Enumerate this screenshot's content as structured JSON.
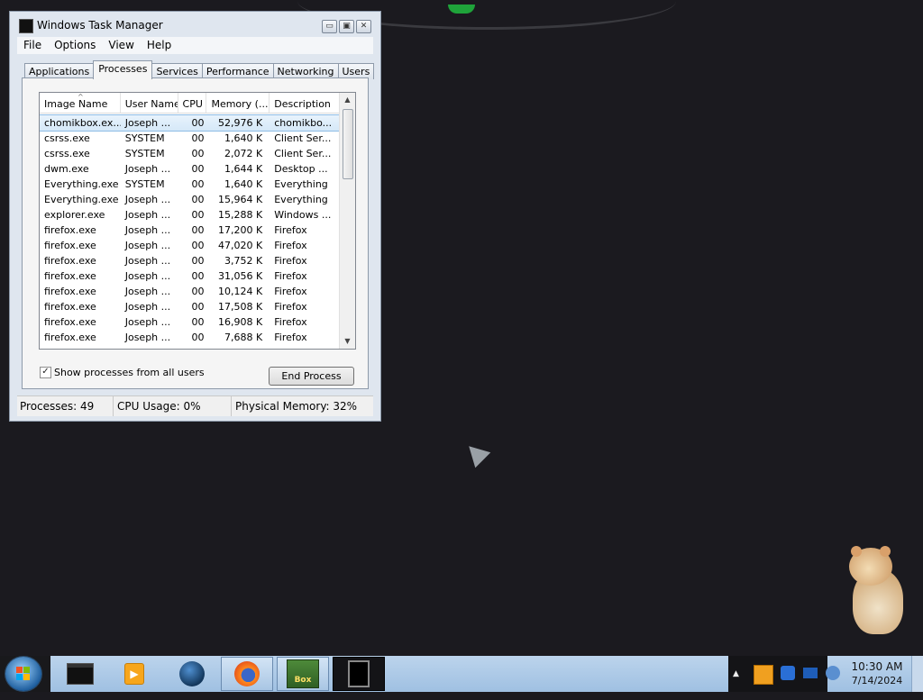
{
  "window": {
    "title": "Windows Task Manager",
    "controls": {
      "minimize": "▭",
      "maximize": "▣",
      "close": "✕"
    }
  },
  "menu": [
    "File",
    "Options",
    "View",
    "Help"
  ],
  "tabs": [
    "Applications",
    "Processes",
    "Services",
    "Performance",
    "Networking",
    "Users"
  ],
  "active_tab": "Processes",
  "columns": [
    "Image Name",
    "User Name",
    "CPU",
    "Memory (...",
    "Description"
  ],
  "processes": [
    {
      "name": "chomikbox.ex...",
      "user": "Joseph ...",
      "cpu": "00",
      "mem": "52,976 K",
      "desc": "chomikbo...",
      "selected": true
    },
    {
      "name": "csrss.exe",
      "user": "SYSTEM",
      "cpu": "00",
      "mem": "1,640 K",
      "desc": "Client Ser..."
    },
    {
      "name": "csrss.exe",
      "user": "SYSTEM",
      "cpu": "00",
      "mem": "2,072 K",
      "desc": "Client Ser..."
    },
    {
      "name": "dwm.exe",
      "user": "Joseph ...",
      "cpu": "00",
      "mem": "1,644 K",
      "desc": "Desktop ..."
    },
    {
      "name": "Everything.exe",
      "user": "SYSTEM",
      "cpu": "00",
      "mem": "1,640 K",
      "desc": "Everything"
    },
    {
      "name": "Everything.exe",
      "user": "Joseph ...",
      "cpu": "00",
      "mem": "15,964 K",
      "desc": "Everything"
    },
    {
      "name": "explorer.exe",
      "user": "Joseph ...",
      "cpu": "00",
      "mem": "15,288 K",
      "desc": "Windows ..."
    },
    {
      "name": "firefox.exe",
      "user": "Joseph ...",
      "cpu": "00",
      "mem": "17,200 K",
      "desc": "Firefox"
    },
    {
      "name": "firefox.exe",
      "user": "Joseph ...",
      "cpu": "00",
      "mem": "47,020 K",
      "desc": "Firefox"
    },
    {
      "name": "firefox.exe",
      "user": "Joseph ...",
      "cpu": "00",
      "mem": "3,752 K",
      "desc": "Firefox"
    },
    {
      "name": "firefox.exe",
      "user": "Joseph ...",
      "cpu": "00",
      "mem": "31,056 K",
      "desc": "Firefox"
    },
    {
      "name": "firefox.exe",
      "user": "Joseph ...",
      "cpu": "00",
      "mem": "10,124 K",
      "desc": "Firefox"
    },
    {
      "name": "firefox.exe",
      "user": "Joseph ...",
      "cpu": "00",
      "mem": "17,508 K",
      "desc": "Firefox"
    },
    {
      "name": "firefox.exe",
      "user": "Joseph ...",
      "cpu": "00",
      "mem": "16,908 K",
      "desc": "Firefox"
    },
    {
      "name": "firefox.exe",
      "user": "Joseph ...",
      "cpu": "00",
      "mem": "7,688 K",
      "desc": "Firefox"
    }
  ],
  "show_all_users": {
    "label": "Show processes from all users",
    "checked": true,
    "mark": "✓"
  },
  "end_process_label": "End Process",
  "status": {
    "processes": "Processes: 49",
    "cpu": "CPU Usage: 0%",
    "memory": "Physical Memory: 32%"
  },
  "taskbar": {
    "pinned": [
      {
        "name": "terminal-icon",
        "running": false
      },
      {
        "name": "media-player-icon",
        "running": false
      },
      {
        "name": "globe-icon",
        "running": false
      },
      {
        "name": "firefox-icon",
        "running": true
      },
      {
        "name": "chomikbox-icon",
        "running": true,
        "label": "Box"
      },
      {
        "name": "task-manager-icon",
        "running": true
      }
    ],
    "clock": {
      "time": "10:30 AM",
      "date": "7/14/2024"
    }
  },
  "colors": {
    "desktop": "#1b1a1f",
    "selection": "#d5e8f8",
    "taskbar": "#a9c6e4"
  }
}
